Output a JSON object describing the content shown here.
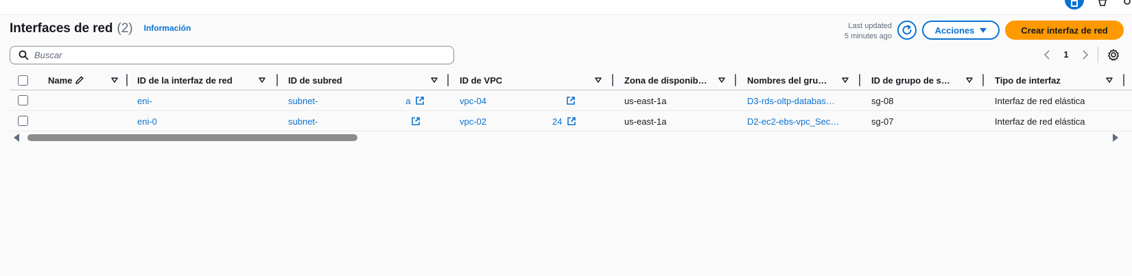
{
  "header": {
    "title": "Interfaces de red",
    "count": "(2)",
    "info_link": "Información",
    "last_updated_line1": "Last updated",
    "last_updated_line2": "5 minutes ago",
    "actions_label": "Acciones",
    "create_label": "Crear interfaz de red"
  },
  "search": {
    "placeholder": "Buscar",
    "value": ""
  },
  "pagination": {
    "current_page": "1"
  },
  "table": {
    "columns": [
      "Name",
      "ID de la interfaz de red",
      "ID de subred",
      "ID de VPC",
      "Zona de disponib…",
      "Nombres del gru…",
      "ID de grupo de s…",
      "Tipo de interfaz"
    ],
    "rows": [
      {
        "name": "",
        "eni": "eni-",
        "subnet": "subnet-",
        "subnet_tail": "a",
        "vpc": "vpc-04",
        "az": "us-east-1a",
        "sg_name": "D3-rds-oltp-databas…",
        "sg_id": "sg-08",
        "type": "Interfaz de red elástica"
      },
      {
        "name": "",
        "eni": "eni-0",
        "subnet": "subnet-",
        "subnet_tail": "",
        "vpc": "vpc-02",
        "vpc_tail": "24",
        "az": "us-east-1a",
        "sg_name": "D2-ec2-ebs-vpc_Sec…",
        "sg_id": "sg-07",
        "type": "Interfaz de red elástica"
      }
    ]
  },
  "colors": {
    "link": "#0972d3",
    "primary_button": "#ff9900",
    "text": "#16191f",
    "muted": "#5f6b7a"
  },
  "icons": [
    "search-icon",
    "refresh-icon",
    "caret-down-icon",
    "chevron-left-icon",
    "chevron-right-icon",
    "gear-icon",
    "pencil-icon",
    "sort-icon",
    "external-link-icon"
  ]
}
